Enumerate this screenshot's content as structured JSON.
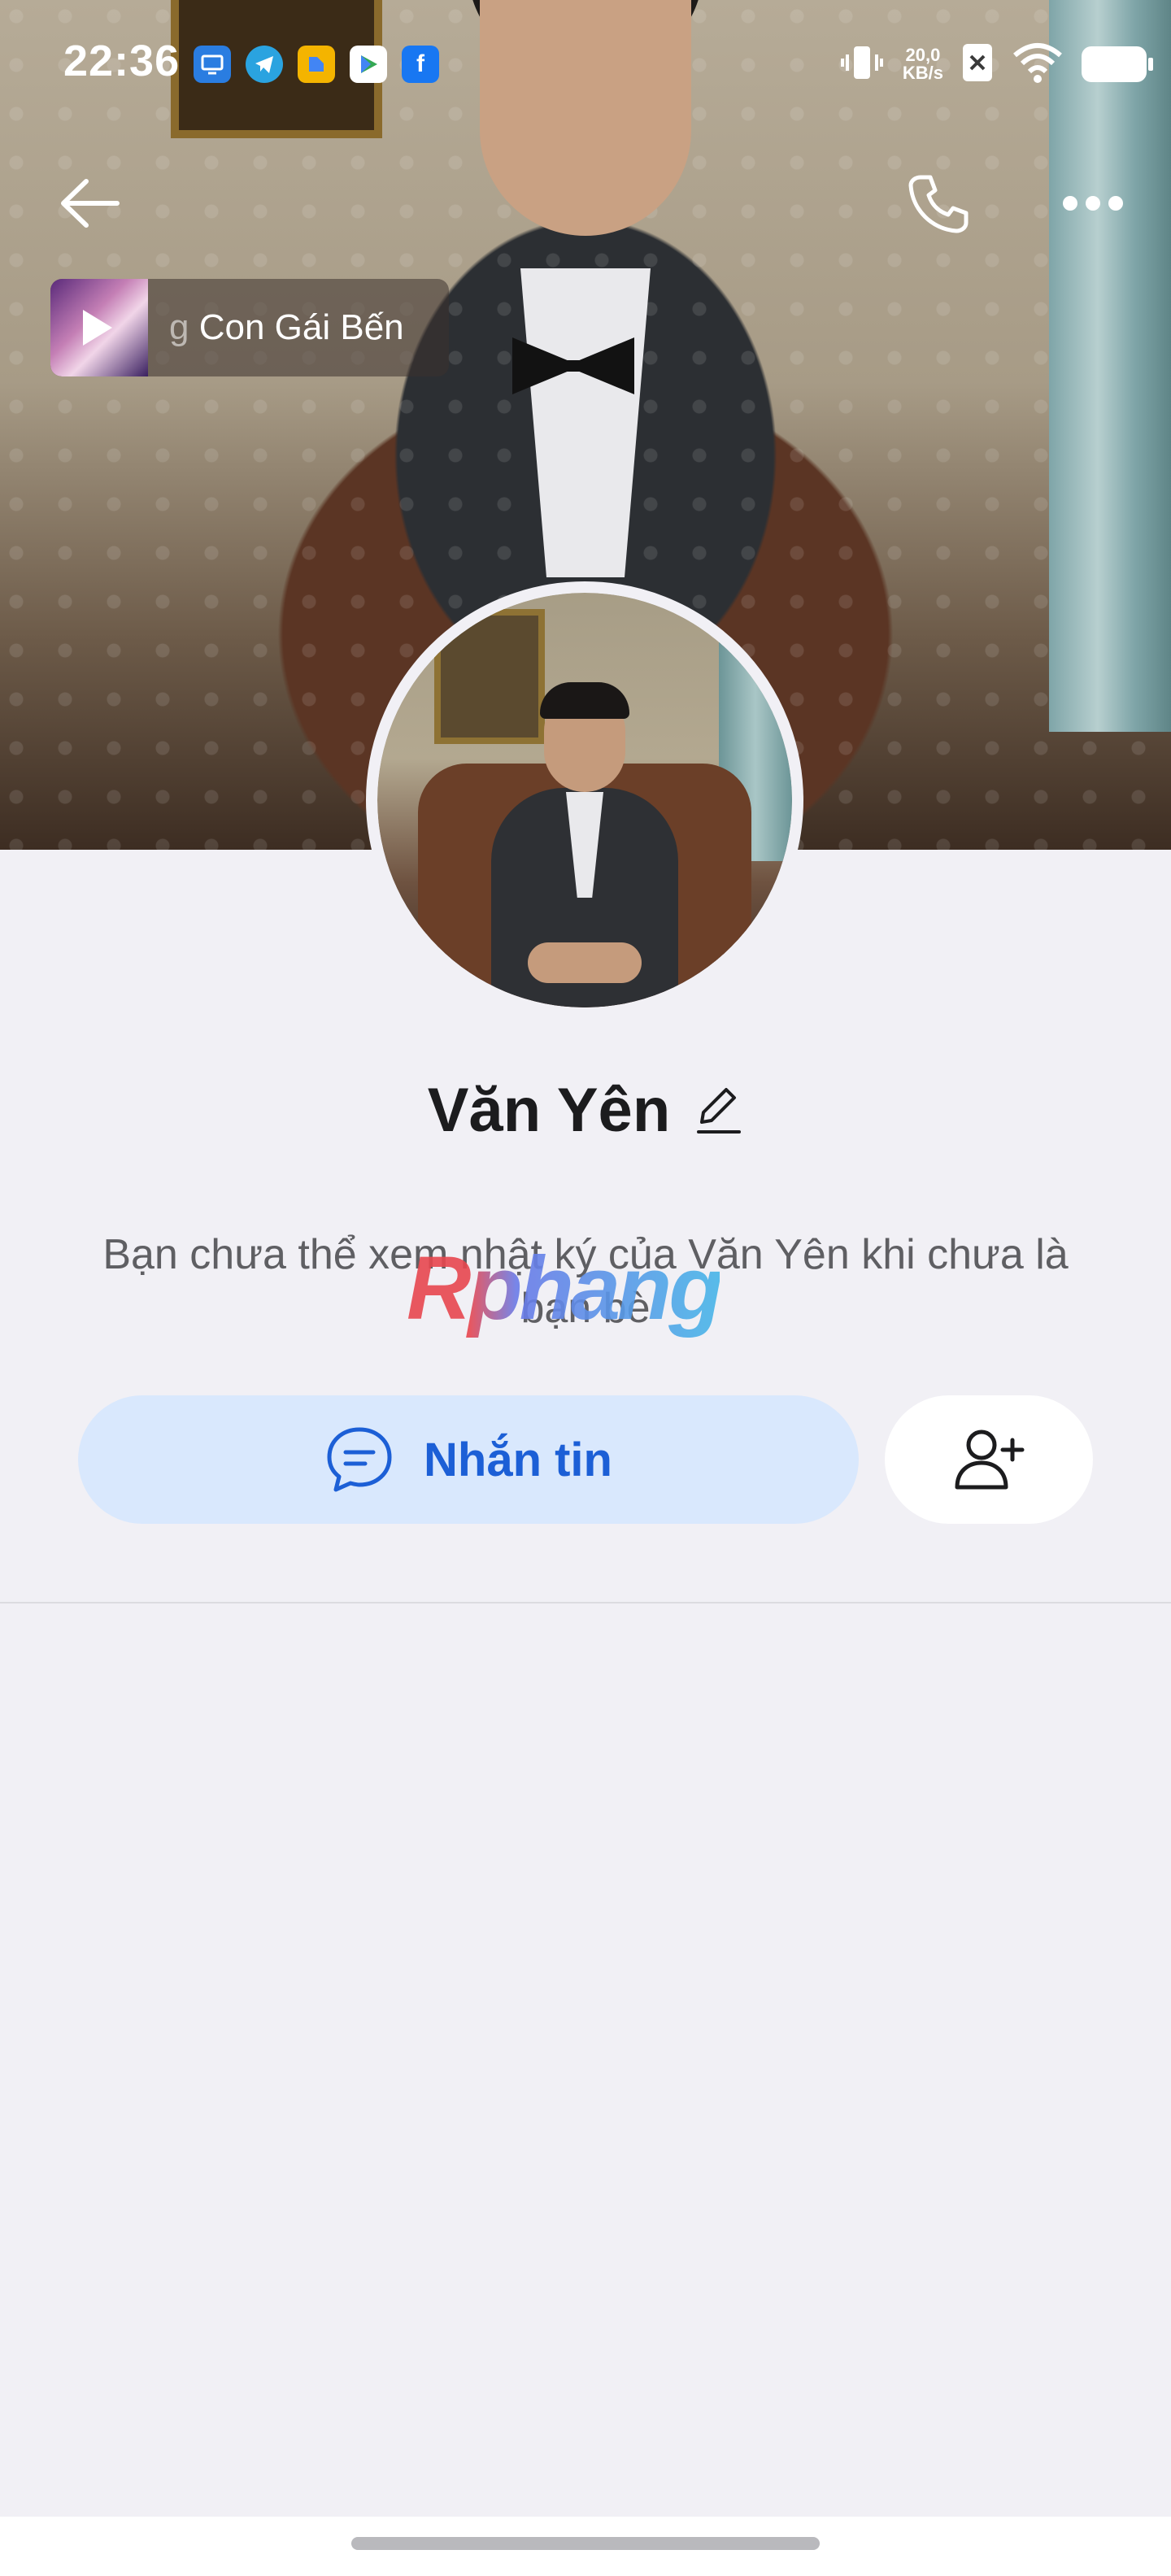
{
  "status_bar": {
    "time": "22:36",
    "network_speed_value": "20,0",
    "network_speed_unit": "KB/s",
    "app_icons": [
      "screen-mirror-icon",
      "telegram-icon",
      "files-icon",
      "google-play-icon",
      "facebook-icon"
    ]
  },
  "header": {
    "back_icon": "arrow-left-icon",
    "call_icon": "phone-icon",
    "more_icon": "more-horizontal-icon"
  },
  "music": {
    "title_faded": "g ",
    "title": "Con Gái Bến"
  },
  "profile": {
    "name": "Văn Yên",
    "notice": "Bạn chưa thể xem nhật ký của Văn Yên khi chưa là bạn bè",
    "watermark": "Rphang"
  },
  "actions": {
    "message_label": "Nhắn tin",
    "message_icon": "chat-bubble-icon",
    "add_friend_icon": "add-user-icon"
  },
  "colors": {
    "accent": "#1c5fd6",
    "message_button_bg": "#d9e8fd",
    "page_bg": "#f1f0f5"
  }
}
